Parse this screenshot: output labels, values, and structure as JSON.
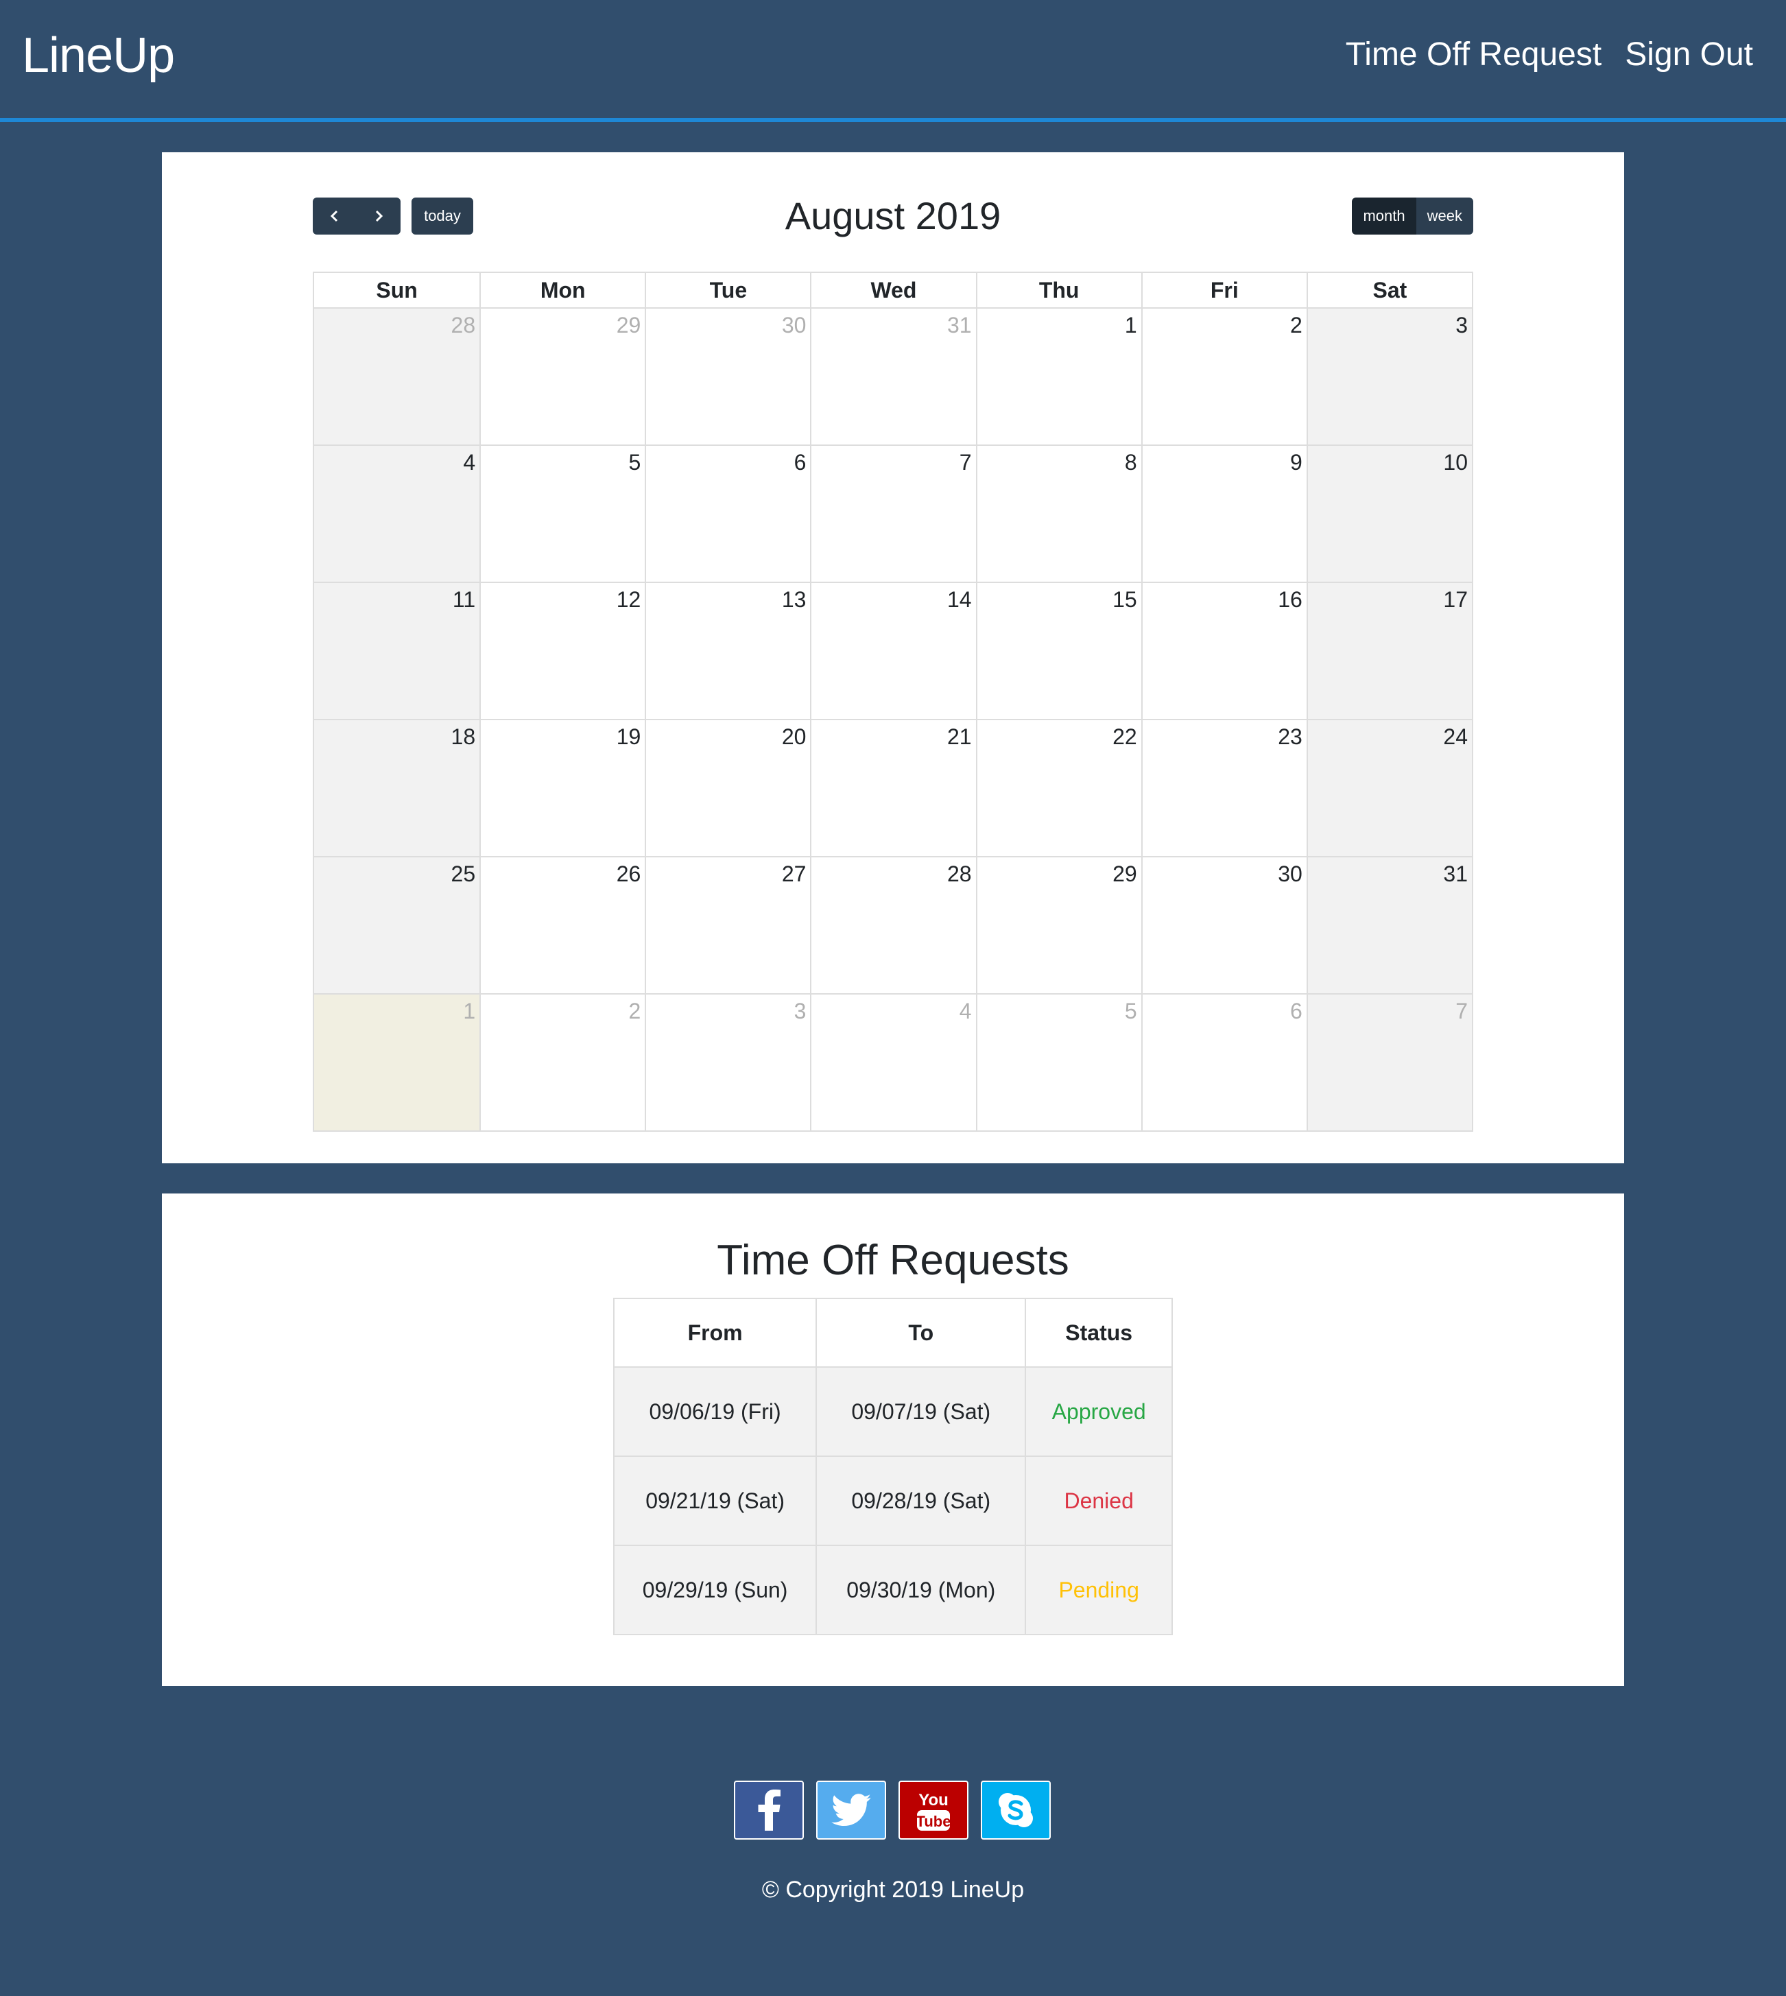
{
  "navbar": {
    "brand": "LineUp",
    "links": [
      "Time Off Request",
      "Sign Out"
    ]
  },
  "calendar": {
    "title": "August 2019",
    "prev_icon": "chevron-left-icon",
    "next_icon": "chevron-right-icon",
    "today_label": "today",
    "views": [
      "month",
      "week"
    ],
    "active_view": "month",
    "weekdays": [
      "Sun",
      "Mon",
      "Tue",
      "Wed",
      "Thu",
      "Fri",
      "Sat"
    ],
    "days": [
      {
        "n": "28",
        "other": true
      },
      {
        "n": "29",
        "other": true
      },
      {
        "n": "30",
        "other": true
      },
      {
        "n": "31",
        "other": true
      },
      {
        "n": "1"
      },
      {
        "n": "2"
      },
      {
        "n": "3"
      },
      {
        "n": "4"
      },
      {
        "n": "5"
      },
      {
        "n": "6"
      },
      {
        "n": "7"
      },
      {
        "n": "8"
      },
      {
        "n": "9"
      },
      {
        "n": "10"
      },
      {
        "n": "11"
      },
      {
        "n": "12"
      },
      {
        "n": "13"
      },
      {
        "n": "14"
      },
      {
        "n": "15"
      },
      {
        "n": "16"
      },
      {
        "n": "17"
      },
      {
        "n": "18"
      },
      {
        "n": "19"
      },
      {
        "n": "20"
      },
      {
        "n": "21"
      },
      {
        "n": "22"
      },
      {
        "n": "23"
      },
      {
        "n": "24"
      },
      {
        "n": "25"
      },
      {
        "n": "26"
      },
      {
        "n": "27"
      },
      {
        "n": "28"
      },
      {
        "n": "29"
      },
      {
        "n": "30"
      },
      {
        "n": "31"
      },
      {
        "n": "1",
        "other": true,
        "today": true
      },
      {
        "n": "2",
        "other": true
      },
      {
        "n": "3",
        "other": true
      },
      {
        "n": "4",
        "other": true
      },
      {
        "n": "5",
        "other": true
      },
      {
        "n": "6",
        "other": true
      },
      {
        "n": "7",
        "other": true
      }
    ]
  },
  "requests": {
    "title": "Time Off Requests",
    "headers": [
      "From",
      "To",
      "Status"
    ],
    "rows": [
      {
        "from": "09/06/19 (Fri)",
        "to": "09/07/19 (Sat)",
        "status": "Approved",
        "color": "#28a745"
      },
      {
        "from": "09/21/19 (Sat)",
        "to": "09/28/19 (Sat)",
        "status": "Denied",
        "color": "#dc3545"
      },
      {
        "from": "09/29/19 (Sun)",
        "to": "09/30/19 (Mon)",
        "status": "Pending",
        "color": "#ffc107"
      }
    ]
  },
  "footer": {
    "social": [
      {
        "name": "facebook-icon",
        "color": "#3b5998"
      },
      {
        "name": "twitter-icon",
        "color": "#55acee"
      },
      {
        "name": "youtube-icon",
        "color": "#bb0000"
      },
      {
        "name": "skype-icon",
        "color": "#00aff0"
      }
    ],
    "youtube_text": [
      "You",
      "Tube"
    ],
    "copyright": "© Copyright 2019 LineUp"
  }
}
